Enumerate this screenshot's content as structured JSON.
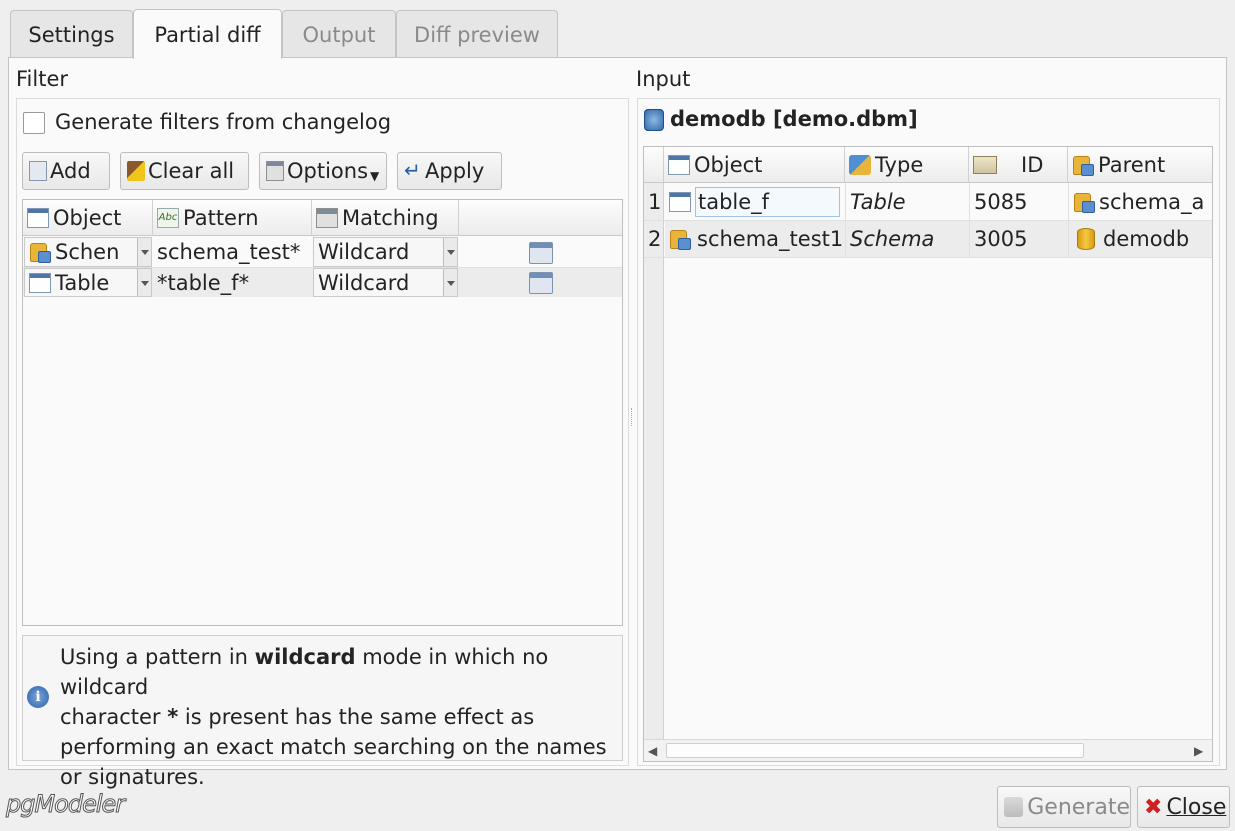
{
  "tabs": [
    {
      "label": "Settings",
      "state": "normal"
    },
    {
      "label": "Partial diff",
      "state": "active"
    },
    {
      "label": "Output",
      "state": "disabled"
    },
    {
      "label": "Diff preview",
      "state": "disabled"
    }
  ],
  "filter": {
    "title": "Filter",
    "generate_checkbox_label": "Generate filters from changelog",
    "generate_checked": false,
    "toolbar": {
      "add_label": "Add",
      "clear_all_label": "Clear all",
      "options_label": "Options",
      "apply_label": "Apply"
    },
    "table": {
      "headers": [
        "Object",
        "Pattern",
        "Matching"
      ],
      "rows": [
        {
          "object": "Schen",
          "object_icon": "schema-icon",
          "pattern": "schema_test*",
          "matching": "Wildcard"
        },
        {
          "object": "Table",
          "object_icon": "table-icon",
          "pattern": "*table_f*",
          "matching": "Wildcard"
        }
      ]
    },
    "info": {
      "pre": "Using a pattern in ",
      "bold1": "wildcard",
      "mid1": " mode in which no wildcard",
      "line2_pre": "character ",
      "bold2": "*",
      "line2_post": " is present has the same effect as",
      "line3": "performing an exact match searching on the names",
      "line4": "or signatures."
    }
  },
  "input": {
    "title": "Input",
    "model_label": "demodb [demo.dbm]",
    "table": {
      "headers": [
        "Object",
        "Type",
        "ID",
        "Parent"
      ],
      "rows": [
        {
          "num": "1",
          "object": "table_f",
          "object_icon": "table-icon",
          "type": "Table",
          "id": "5085",
          "parent": "schema_a",
          "parent_icon": "schema-icon"
        },
        {
          "num": "2",
          "object": "schema_test1",
          "object_icon": "schema-icon",
          "type": "Schema",
          "id": "3005",
          "parent": "demodb",
          "parent_icon": "database-icon"
        }
      ]
    }
  },
  "footer": {
    "logo_text": "pgModeler",
    "generate_label": "Generate",
    "close_label": "Close"
  },
  "colors": {
    "active_tab": "#fafafa",
    "inactive_tab_text": "#8a8a8a",
    "selected_cell_border": "#9ec3e6",
    "close_icon": "#d02020"
  }
}
